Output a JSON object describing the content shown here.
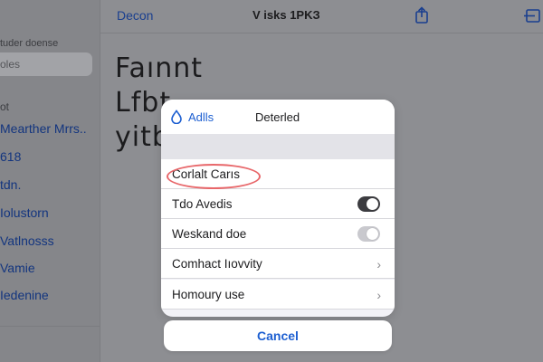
{
  "sidebar": {
    "header": "tuder doense",
    "search": {
      "placeholder": "oles"
    },
    "section": "ot",
    "items": [
      {
        "label": "Mearther Mrrs.."
      },
      {
        "label": "618"
      },
      {
        "label": "tdn."
      },
      {
        "label": "Iolustorn"
      },
      {
        "label": "Vatlnosss"
      },
      {
        "label": "Vamie"
      },
      {
        "label": "Iedenine"
      }
    ]
  },
  "header": {
    "back_label": "Decon",
    "title": "V isks 1PKЗ",
    "icons": [
      "share-icon",
      "compose-icon"
    ]
  },
  "document": {
    "lines": [
      "Faınnt",
      "Lfbt",
      "yitb"
    ]
  },
  "sheet": {
    "action_label": "Adlls",
    "action_icon": "drop-icon",
    "title": "Deterled",
    "rows": [
      {
        "label": "Corlalt Carıs",
        "control": "none",
        "highlighted": true
      },
      {
        "label": "Tdo Avedis",
        "control": "toggle",
        "toggle_on": true
      },
      {
        "label": "Weskand doe",
        "control": "toggle",
        "toggle_on": false
      },
      {
        "label": "Comhact Iıovvity",
        "control": "chevron"
      },
      {
        "label": "Homoury use",
        "control": "chevron"
      }
    ],
    "cancel_label": "Cancel"
  },
  "colors": {
    "accent": "#1d5fd1",
    "highlight": "#e8676a",
    "toggle_on": "#3c3c40",
    "toggle_off": "#c9c9ce"
  }
}
